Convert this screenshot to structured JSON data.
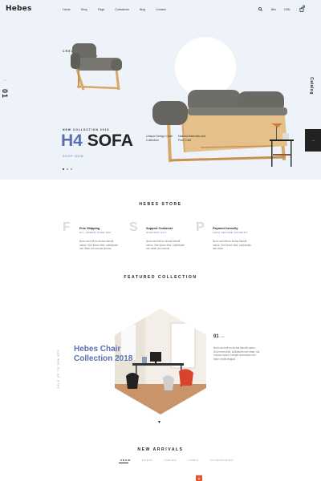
{
  "header": {
    "logo": "Hebes",
    "nav": [
      "Home",
      "Shop",
      "Page",
      "Collections",
      "Blog",
      "Contact"
    ],
    "account_label": "Blio",
    "currency_label": "USD",
    "cart_count": "0"
  },
  "hero": {
    "slide_number": "01",
    "tagline_line1": "CREATIVE SOFA",
    "tagline_line2": "COLLECTION",
    "new_collection": "NEW COLLECTION 2018",
    "title_accent": "H4",
    "title_main": "SOFA",
    "shop_now": "SHOP NOW",
    "desc1": "Unique Design Chair Collection",
    "desc2": "Natural Materials and Fine Craft",
    "catalog": "Catalog",
    "next_arrow": "→"
  },
  "store": {
    "title": "HEBES STORE",
    "features": [
      {
        "letter": "F",
        "title": "Free Shipping",
        "subtitle": "ALL ORDER OVER $99",
        "text": "Nunc sed elit eu lectus blandit varius. Sed lorem felis, sollicitudin nec vitae, dui cursus cursus."
      },
      {
        "letter": "S",
        "title": "Support Customer",
        "subtitle": "SUPPORT 24/7",
        "text": "Nunc sed elit eu lectus blandit varius. Sed lorem felis, sollicitudin nec vitae, dui cursus."
      },
      {
        "letter": "P",
        "title": "Payment security",
        "subtitle": "100% SECURE PAYMENT",
        "text": "Nunc sed elit eu lectus blandit varius. Sed lorem felis, sollicitudin nec vitae."
      }
    ]
  },
  "featured": {
    "title": "FEATURED COLLECTION",
    "collection_title": "Hebes Chair Collection 2018",
    "vertical_label": "SALE UP TO 50% OFF",
    "number": "01",
    "number_total": "/ 04",
    "description": "Nunc sed elit eu lectus blandit varius. Sed lorem felis, sollicitudin nec vitae, dui cursus cursus. Integer accumsan nec dolor mollis feugiat.",
    "down_arrow": "▼"
  },
  "arrivals": {
    "title": "NEW ARRIVALS",
    "tabs": [
      "CHAIR",
      "SOFAS",
      "TABLES",
      "LAMPS",
      "ACCESSORIES"
    ],
    "scroll_top": "▲"
  },
  "colors": {
    "accent": "#5b6fb0",
    "hero_bg": "#eef3f9",
    "cta": "#e8542b"
  }
}
